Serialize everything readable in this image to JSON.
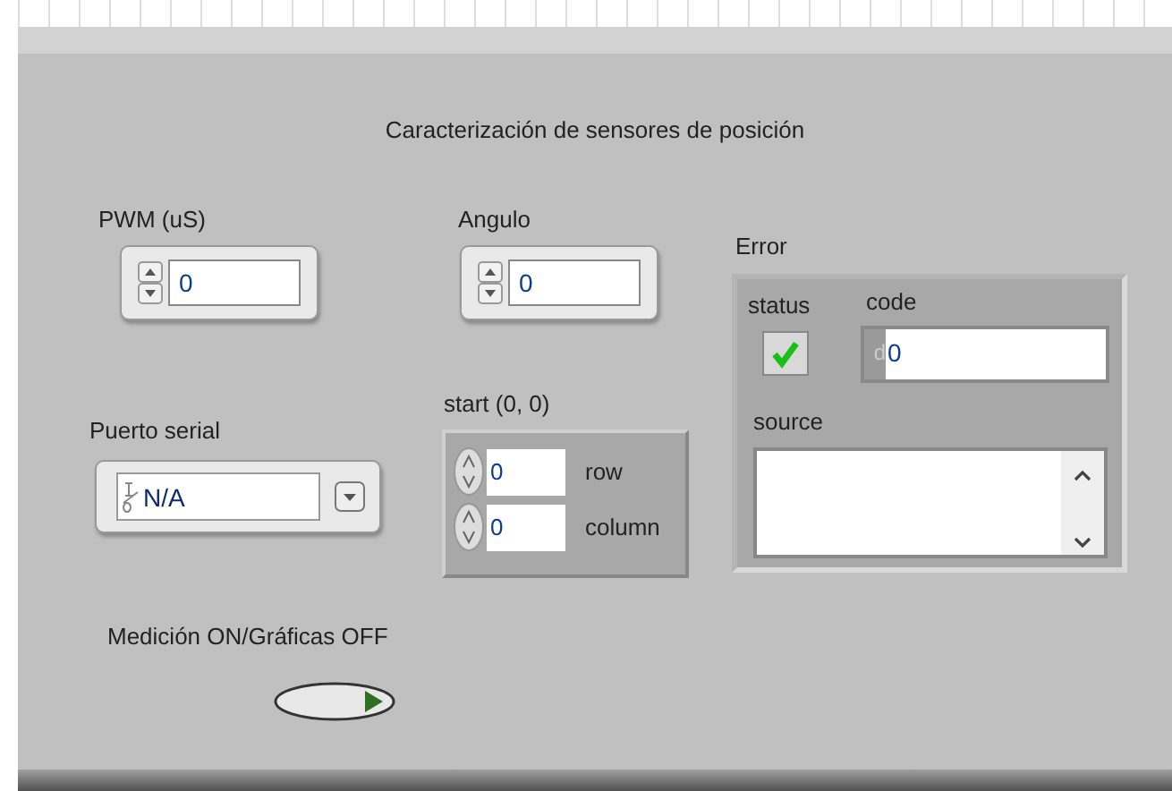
{
  "panel": {
    "title": "Caracterización de sensores de posición"
  },
  "numerics": [
    {
      "label": "PWM (uS)",
      "value": "0"
    },
    {
      "label": "Angulo",
      "value": "0"
    }
  ],
  "serial_port": {
    "label": "Puerto serial",
    "value": "N/A"
  },
  "array": {
    "label": "start (0, 0)",
    "indices": [
      {
        "value": "0",
        "label": "row"
      },
      {
        "value": "0",
        "label": "column"
      }
    ]
  },
  "error": {
    "label": "Error",
    "status_label": "status",
    "status_ok": true,
    "code_label": "code",
    "code_radix": "d",
    "code": "0",
    "source_label": "source"
  },
  "toggle": {
    "label": "Medición ON/Gráficas OFF",
    "on": false
  }
}
